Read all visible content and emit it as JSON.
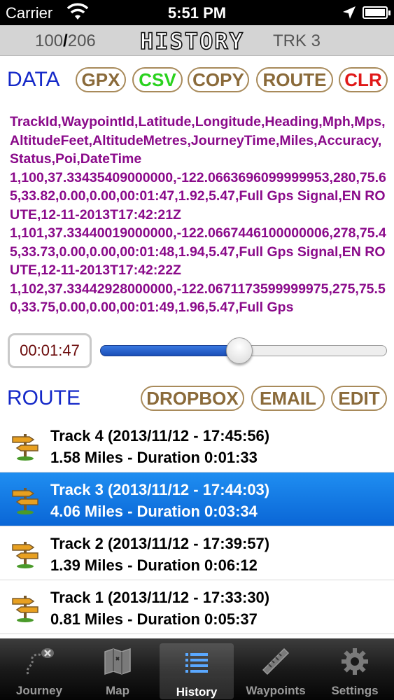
{
  "status_bar": {
    "carrier": "Carrier",
    "time": "5:51 PM"
  },
  "header": {
    "count_current": "100",
    "count_sep": "/",
    "count_total": "206",
    "title": "HISTORY",
    "track": "TRK 3"
  },
  "data_section": {
    "label": "DATA",
    "buttons": {
      "gpx": "GPX",
      "csv": "CSV",
      "copy": "COPY",
      "route": "ROUTE",
      "clr": "CLR"
    },
    "csv_text": "TrackId,WaypointId,Latitude,Longitude,Heading,Mph,Mps,AltitudeFeet,AltitudeMetres,JourneyTime,Miles,Accuracy,Status,Poi,DateTime\n1,100,37.33435409000000,-122.0663696099999953,280,75.65,33.82,0.00,0.00,00:01:47,1.92,5.47,Full Gps Signal,EN ROUTE,12-11-2013T17:42:21Z\n1,101,37.33440019000000,-122.0667446100000006,278,75.45,33.73,0.00,0.00,00:01:48,1.94,5.47,Full Gps Signal,EN ROUTE,12-11-2013T17:42:22Z\n1,102,37.33442928000000,-122.0671173599999975,275,75.50,33.75,0.00,0.00,00:01:49,1.96,5.47,Full Gps"
  },
  "timer": {
    "value": "00:01:47"
  },
  "slider": {
    "position_fraction": 0.485
  },
  "route_section": {
    "label": "ROUTE",
    "buttons": {
      "dropbox": "DROPBOX",
      "email": "EMAIL",
      "edit": "EDIT"
    }
  },
  "tracks": [
    {
      "title": "Track 4 (2013/11/12 - 17:45:56)",
      "detail": "1.58 Miles - Duration 0:01:33",
      "selected": false
    },
    {
      "title": "Track 3 (2013/11/12 - 17:44:03)",
      "detail": "4.06 Miles - Duration 0:03:34",
      "selected": true
    },
    {
      "title": "Track 2 (2013/11/12 - 17:39:57)",
      "detail": "1.39 Miles - Duration 0:06:12",
      "selected": false
    },
    {
      "title": "Track 1 (2013/11/12 - 17:33:30)",
      "detail": "0.81 Miles - Duration 0:05:37",
      "selected": false
    }
  ],
  "tabbar": {
    "tabs": [
      {
        "label": "Journey",
        "icon": "journey-icon"
      },
      {
        "label": "Map",
        "icon": "map-icon"
      },
      {
        "label": "History",
        "icon": "history-list-icon",
        "active": true
      },
      {
        "label": "Waypoints",
        "icon": "ruler-icon"
      },
      {
        "label": "Settings",
        "icon": "gear-icon"
      }
    ]
  },
  "colors": {
    "accent_blue": "#1428c8",
    "csv_text": "#8a0a8a",
    "selection": "#0a66d6",
    "pill_border": "#a88a5a"
  }
}
